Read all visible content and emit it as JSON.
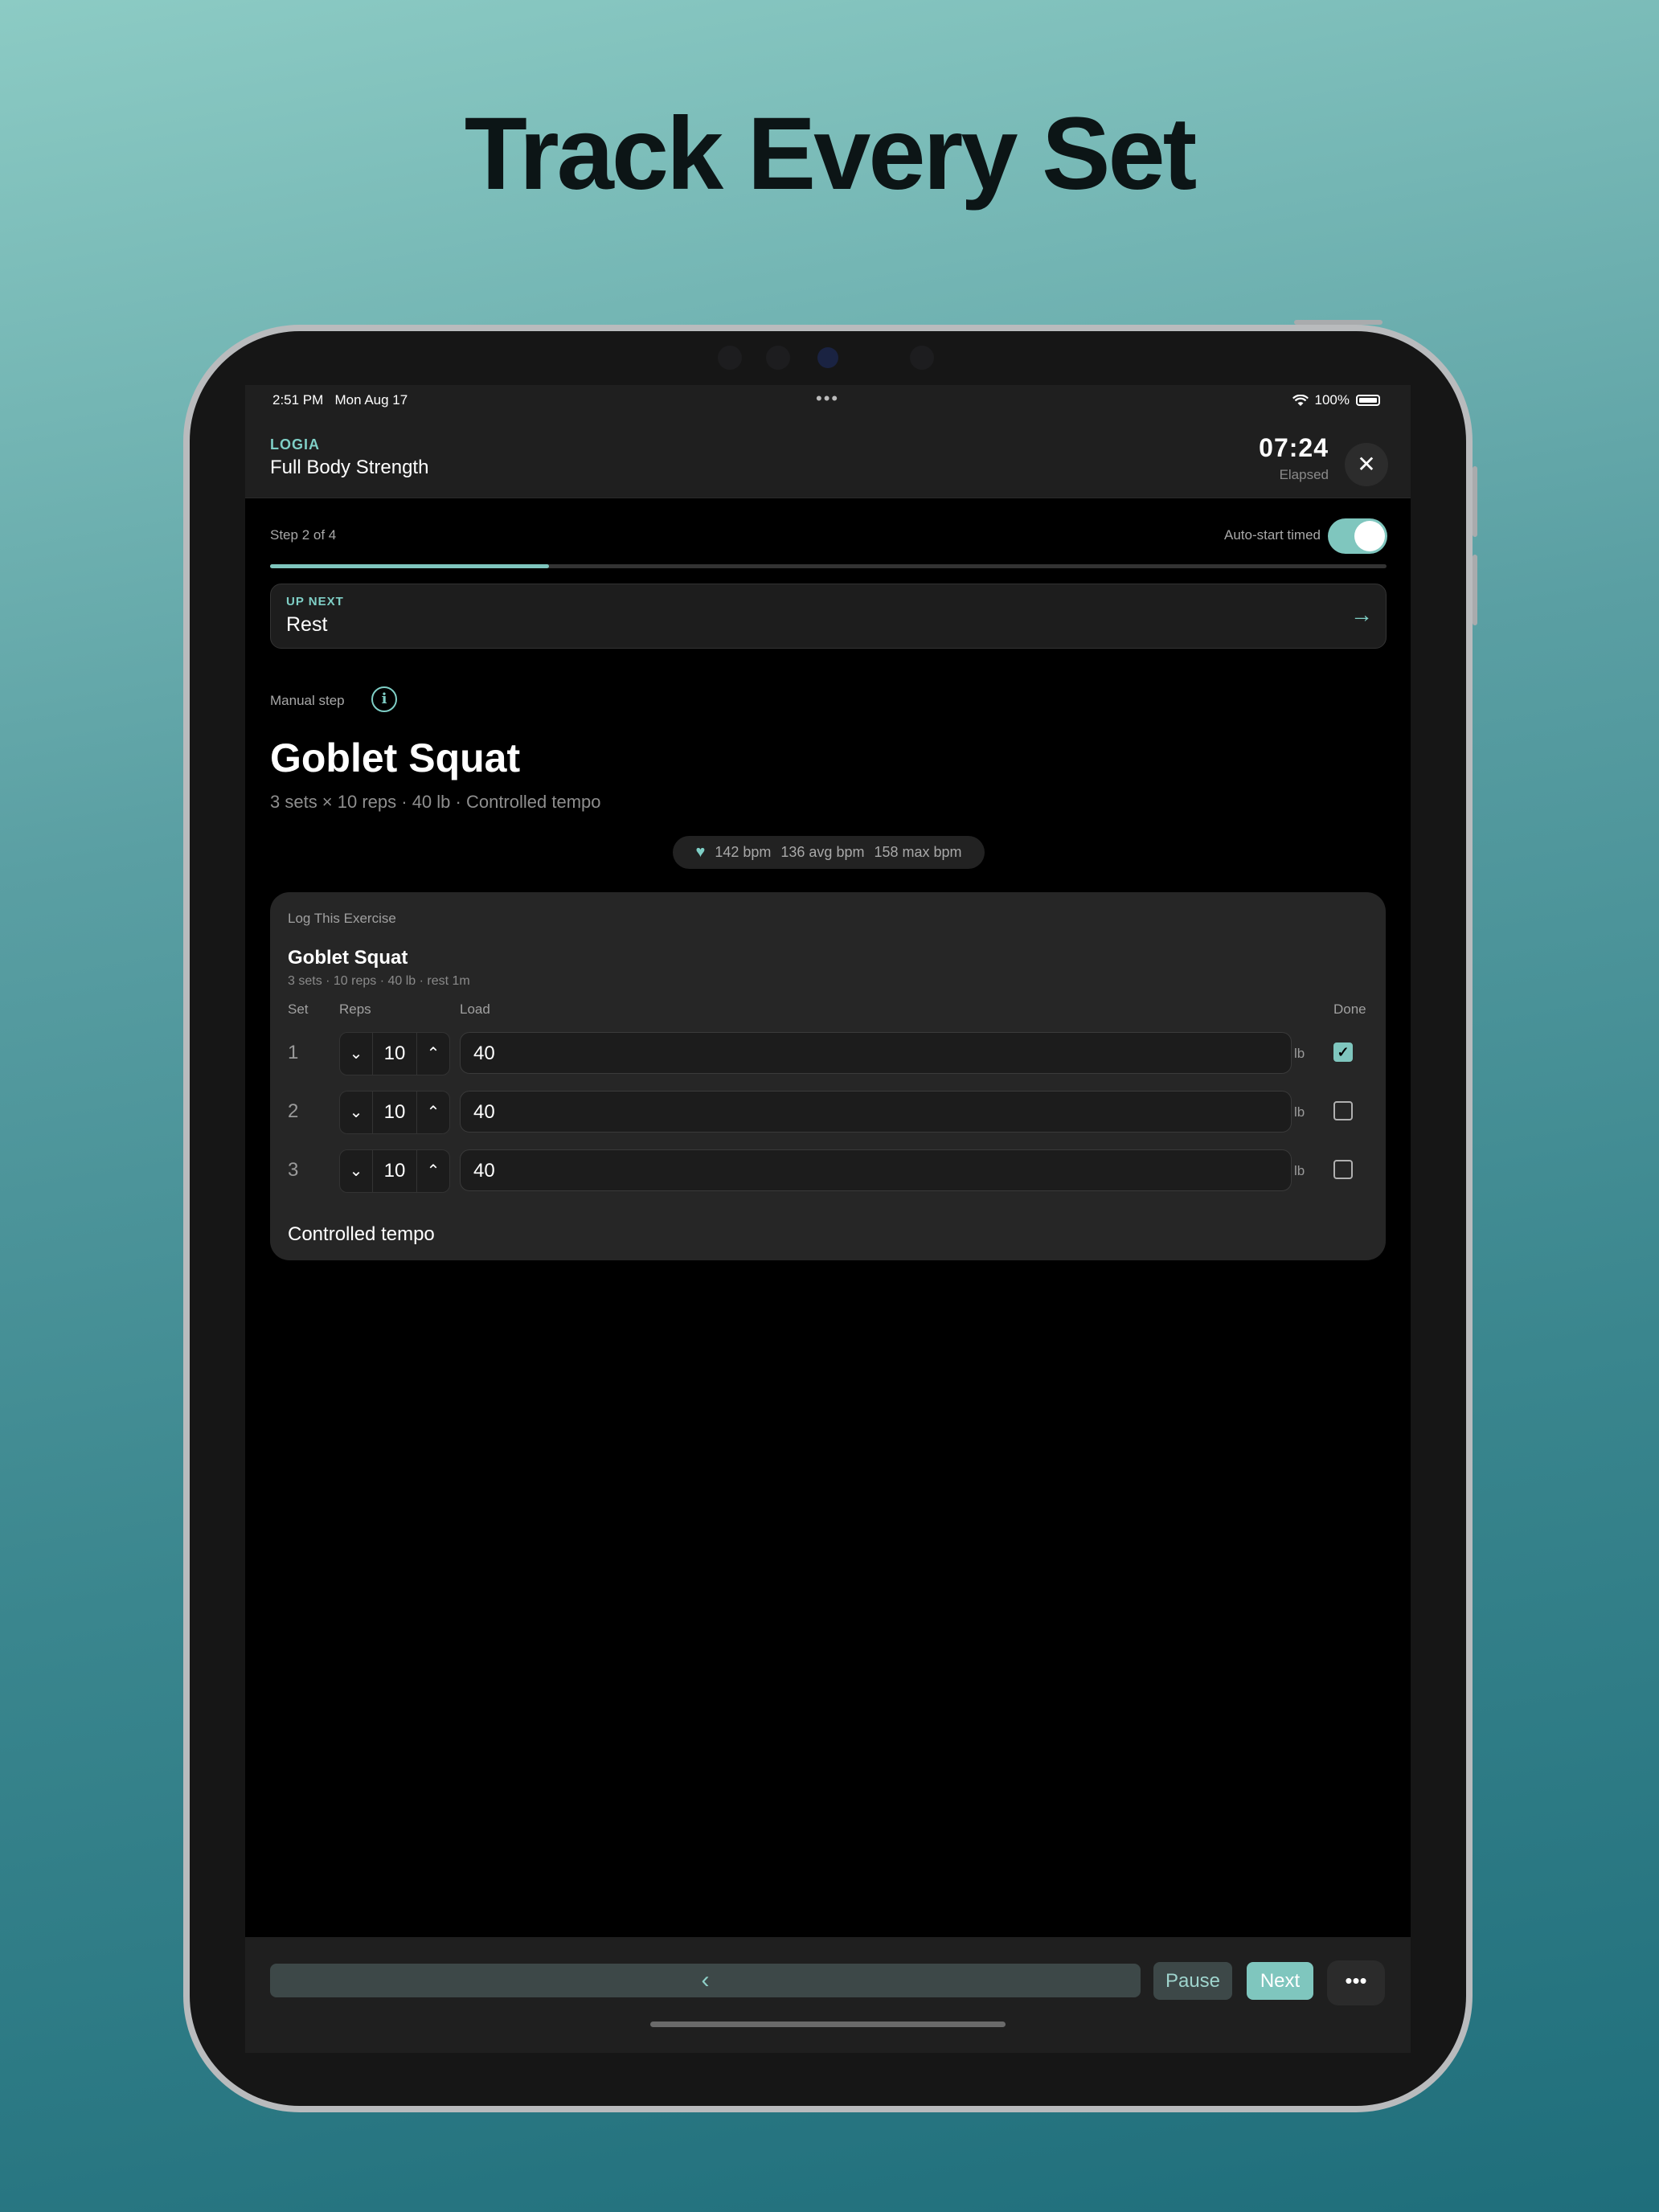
{
  "headline": "Track Every Set",
  "colors": {
    "accent": "#7fc6be",
    "background_top": "#8ccbc4",
    "background_bottom": "#1f6e7b"
  },
  "status_bar": {
    "time": "2:51 PM",
    "date": "Mon Aug 17",
    "battery": "100%",
    "multitask_icon": "three-dots-icon",
    "wifi_icon": "wifi-icon",
    "battery_icon": "battery-icon"
  },
  "header": {
    "brand": "LOGIA",
    "workout_title": "Full Body Strength",
    "timer": "07:24",
    "timer_label": "Elapsed",
    "close_icon": "close-icon"
  },
  "progress": {
    "step_label": "Step 2 of 4",
    "auto_start_label": "Auto-start timed",
    "auto_start_on": true,
    "fraction": 0.25
  },
  "up_next": {
    "label": "UP NEXT",
    "value": "Rest",
    "icon": "arrow-right-icon"
  },
  "exercise": {
    "step_type": "Manual step",
    "info_icon": "info-icon",
    "title": "Goblet Squat",
    "subtitle": "3 sets × 10 reps · 40 lb · Controlled tempo"
  },
  "heart_rate": {
    "icon": "heart-icon",
    "current": "142 bpm",
    "avg": "136 avg bpm",
    "max": "158 max bpm"
  },
  "log_card": {
    "label": "Log This Exercise",
    "name": "Goblet Squat",
    "meta": "3 sets · 10 reps · 40 lb · rest 1m",
    "headers": {
      "set": "Set",
      "reps": "Reps",
      "load": "Load",
      "done": "Done"
    },
    "unit": "lb",
    "sets": [
      {
        "set": "1",
        "reps": "10",
        "load": "40",
        "done": true
      },
      {
        "set": "2",
        "reps": "10",
        "load": "40",
        "done": false
      },
      {
        "set": "3",
        "reps": "10",
        "load": "40",
        "done": false
      }
    ],
    "notes": "Controlled tempo"
  },
  "bottom_bar": {
    "back_icon": "chevron-left-icon",
    "pause_label": "Pause",
    "next_label": "Next",
    "more_icon": "more-icon"
  }
}
